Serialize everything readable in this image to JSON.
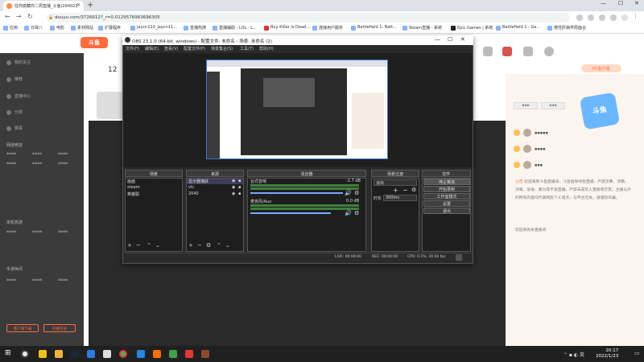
{
  "browser": {
    "tab_title": "任你搞藏你二周直播_斗鱼(294023",
    "url": "douyu.com/3726612?_r=0.0129576963696305",
    "bookmarks": [
      "应用",
      "日珠八",
      "电影",
      "素材网站",
      "扩展程序",
      "jaycn110_jaycn11...",
      "直播热搜",
      "直播辅助 - LOL - L...",
      "Buy Killer is Dead...",
      "连接用户服务",
      "Battlefield 1: Batt...",
      "Steam直播 - 系统",
      "Epic Games | 系统",
      "Battlefield 1 - Ga...",
      "慢性肝病学局面合"
    ]
  },
  "site": {
    "logo": "斗鱼",
    "sidebar_items": [
      "我的关注",
      "推荐",
      "直播中心",
      "分类",
      "赛事"
    ],
    "sidebar_section_labels": [
      "网游竞技",
      "单机热游",
      "手游休闲"
    ],
    "sidebar_footer": [
      "客户端下载",
      "开播方式"
    ],
    "nav_count": "12",
    "pc_button": "PC客户端"
  },
  "chat": {
    "notice_label": "公告",
    "notice_text": "欢迎来到斗鱼直播间，斗鱼倡导绿色直播，严禁涉黄、涉赌、涉毒、低俗、暴力等不良直播。严禁未成年人直播或打赏。主播以外的所有内容均代表网友个人观点，与平台无关，请谨防诈骗。",
    "system_text": "欢迎来到本直播间"
  },
  "obs": {
    "title": "OBS 23.1.0 (64-bit, windows) - 配置文件: 未命名 - 场景: 未命名 (2)",
    "menu": [
      "文件(F)",
      "编辑(E)",
      "查看(V)",
      "配置文件(P)",
      "场景集合(S)",
      "工具(T)",
      "帮助(H)"
    ],
    "docks": {
      "scenes": "场景",
      "sources": "来源",
      "mixer": "混音器",
      "transitions": "场景过渡",
      "controls": "控件"
    },
    "scenes": [
      "画面",
      "steam",
      "英雄联"
    ],
    "sources": [
      "显示器捕获",
      "vlc",
      "2040"
    ],
    "mixer_channels": [
      {
        "name": "台式音响",
        "level": "-1.7 dB"
      },
      {
        "name": "麦克风/Aux",
        "level": "0.0 dB"
      }
    ],
    "transition": {
      "name": "淡出",
      "duration_label": "时长",
      "duration": "300ms"
    },
    "controls": [
      "停止推流",
      "开始录制",
      "工作室模式",
      "设置",
      "退出"
    ],
    "status": {
      "live": "LIVE: 00:00:00",
      "rec": "REC: 00:00:00",
      "cpu": "CPU: 0.1%, 30.00 fps"
    }
  },
  "taskbar": {
    "time": "20:17",
    "date": "2022/1/23"
  }
}
